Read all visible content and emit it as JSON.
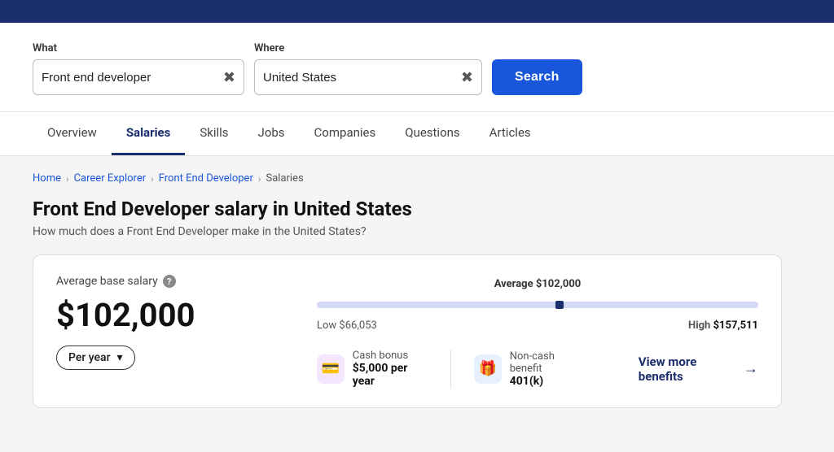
{
  "header": {
    "bg_color": "#1a2d6d"
  },
  "search": {
    "what_label": "What",
    "what_value": "Front end developer",
    "where_label": "Where",
    "where_value": "United States",
    "search_button": "Search"
  },
  "nav": {
    "tabs": [
      {
        "label": "Overview",
        "active": false
      },
      {
        "label": "Salaries",
        "active": true
      },
      {
        "label": "Skills",
        "active": false
      },
      {
        "label": "Jobs",
        "active": false
      },
      {
        "label": "Companies",
        "active": false
      },
      {
        "label": "Questions",
        "active": false
      },
      {
        "label": "Articles",
        "active": false
      }
    ]
  },
  "breadcrumb": {
    "home": "Home",
    "career_explorer": "Career Explorer",
    "role": "Front End Developer",
    "current": "Salaries"
  },
  "page": {
    "title": "Front End Developer salary in United States",
    "subtitle": "How much does a Front End Developer make in the United States?"
  },
  "salary_card": {
    "avg_label": "Average base salary",
    "help": "?",
    "amount": "$102,000",
    "period": "Per year",
    "chart": {
      "avg_label": "Average",
      "avg_value": "$102,000",
      "low_label": "Low",
      "low_value": "$66,053",
      "high_label": "High",
      "high_value": "$157,511"
    }
  },
  "benefits": [
    {
      "icon": "💳",
      "icon_class": "cash",
      "name": "Cash bonus",
      "value": "$5,000 per year"
    },
    {
      "icon": "🎁",
      "icon_class": "noncash",
      "name": "Non-cash benefit",
      "value": "401(k)"
    }
  ],
  "view_more": "View more benefits"
}
